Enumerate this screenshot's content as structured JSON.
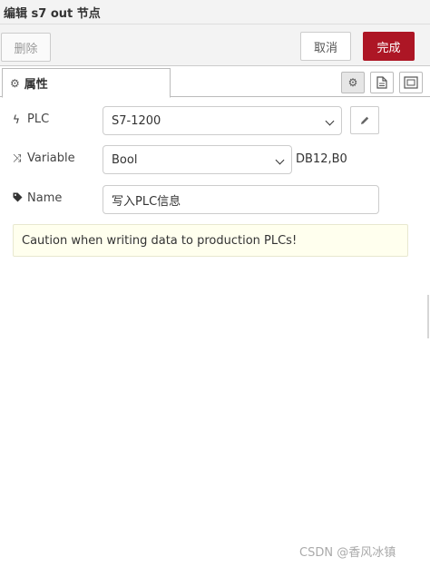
{
  "window": {
    "title": "编辑 s7 out 节点"
  },
  "toolbar": {
    "delete_label": "删除",
    "cancel_label": "取消",
    "done_label": "完成"
  },
  "tabs": {
    "properties_label": "属性"
  },
  "form": {
    "plc": {
      "label": "PLC",
      "value": "S7-1200"
    },
    "variable": {
      "label": "Variable",
      "value": "Bool",
      "address": "DB12,B0"
    },
    "name": {
      "label": "Name",
      "value": "写入PLC信息"
    }
  },
  "notice": {
    "text": "Caution when writing data to production PLCs!"
  },
  "watermark": {
    "text": "CSDN @香风冰镇"
  },
  "colors": {
    "done_button": "#ad1625",
    "notice_bg": "#ffffee"
  }
}
